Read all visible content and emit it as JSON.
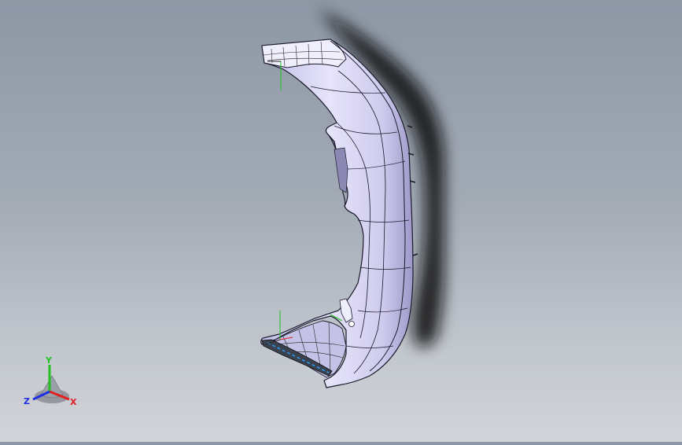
{
  "viewport": {
    "background_top": "#8d97a5",
    "background_bottom": "#d1d4d8",
    "part_color": "#d6d3f2",
    "edge_color": "#1a1a2a",
    "shadow_color": "#111111"
  },
  "triad": {
    "x_label": "X",
    "y_label": "Y",
    "z_label": "Z",
    "x_color": "#e02020",
    "y_color": "#22c022",
    "z_color": "#2030e0"
  }
}
